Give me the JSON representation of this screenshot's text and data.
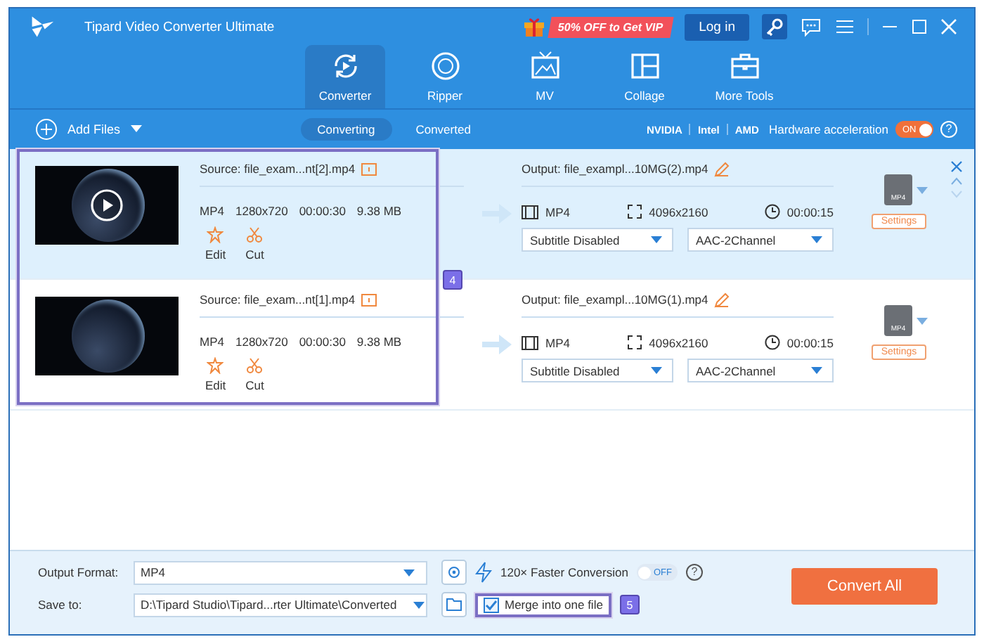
{
  "window": {
    "title": "Tipard Video Converter Ultimate",
    "promo": "50% OFF to Get VIP",
    "login": "Log in"
  },
  "nav_tabs": [
    {
      "label": "Converter",
      "selected": true
    },
    {
      "label": "Ripper",
      "selected": false
    },
    {
      "label": "MV",
      "selected": false
    },
    {
      "label": "Collage",
      "selected": false
    },
    {
      "label": "More Tools",
      "selected": false
    }
  ],
  "toolbar": {
    "add_files": "Add Files",
    "view_tabs": [
      {
        "label": "Converting",
        "selected": true
      },
      {
        "label": "Converted",
        "selected": false
      }
    ],
    "gpu": [
      "NVIDIA",
      "Intel",
      "AMD"
    ],
    "hw_label": "Hardware acceleration",
    "hw_toggle": {
      "label": "ON",
      "on": true
    },
    "help": "?"
  },
  "files": [
    {
      "selected": true,
      "playing_overlay": true,
      "source": "Source: file_exam...nt[2].mp4",
      "format": "MP4",
      "resolution": "1280x720",
      "duration": "00:00:30",
      "size": "9.38 MB",
      "edit": "Edit",
      "cut": "Cut",
      "output": "Output: file_exampl...10MG(2).mp4",
      "out_format": "MP4",
      "out_resolution": "4096x2160",
      "out_duration": "00:00:15",
      "subtitle": "Subtitle Disabled",
      "audio": "AAC-2Channel",
      "format_badge": "MP4",
      "settings": "Settings"
    },
    {
      "selected": false,
      "playing_overlay": false,
      "source": "Source: file_exam...nt[1].mp4",
      "format": "MP4",
      "resolution": "1280x720",
      "duration": "00:00:30",
      "size": "9.38 MB",
      "edit": "Edit",
      "cut": "Cut",
      "output": "Output: file_exampl...10MG(1).mp4",
      "out_format": "MP4",
      "out_resolution": "4096x2160",
      "out_duration": "00:00:15",
      "subtitle": "Subtitle Disabled",
      "audio": "AAC-2Channel",
      "format_badge": "MP4",
      "settings": "Settings"
    }
  ],
  "annotations": [
    {
      "label": "4"
    },
    {
      "label": "5"
    }
  ],
  "bottom": {
    "output_format_label": "Output Format:",
    "output_format": "MP4",
    "save_to_label": "Save to:",
    "save_to": "D:\\Tipard Studio\\Tipard...rter Ultimate\\Converted",
    "faster": "120× Faster Conversion",
    "faster_toggle": {
      "label": "OFF",
      "on": false
    },
    "help": "?",
    "merge": {
      "label": "Merge into one file",
      "checked": true
    },
    "convert_all": "Convert All"
  }
}
